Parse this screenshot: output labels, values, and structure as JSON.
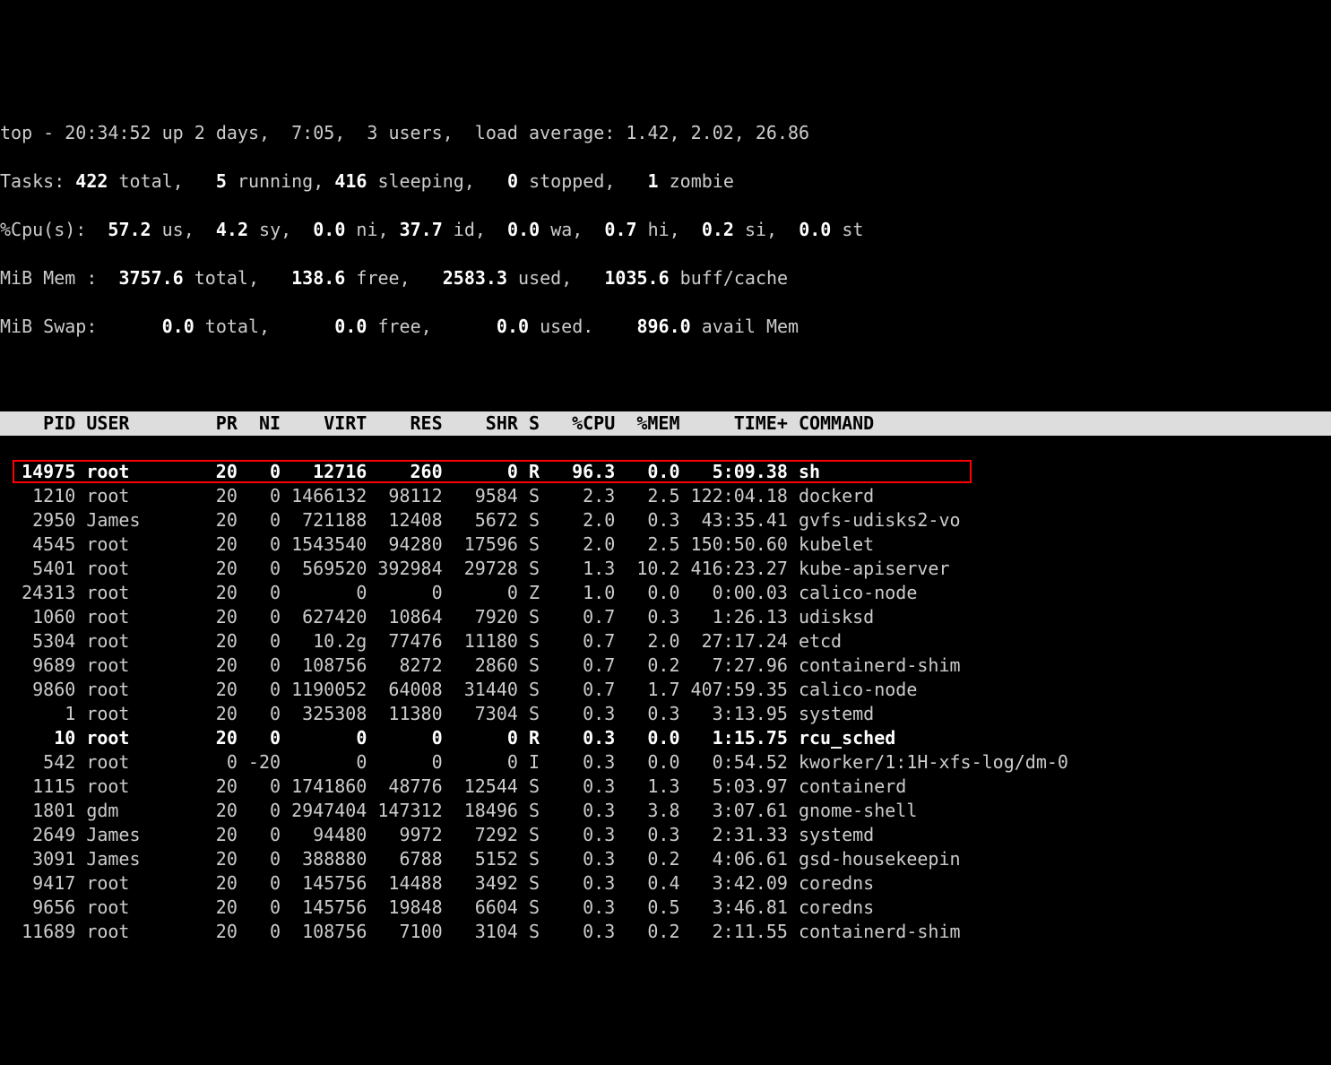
{
  "header": {
    "line1": "top - 20:34:52 up 2 days,  7:05,  3 users,  load average: 1.42, 2.02, 26.86",
    "tasks_label": "Tasks:",
    "tasks_total": "422",
    "tasks_total_label": " total,",
    "tasks_running": "5",
    "tasks_running_label": " running,",
    "tasks_sleeping": "416",
    "tasks_sleeping_label": " sleeping,",
    "tasks_stopped": "0",
    "tasks_stopped_label": " stopped,",
    "tasks_zombie": "1",
    "tasks_zombie_label": " zombie",
    "cpu_label": "%Cpu(s):",
    "cpu_us": "57.2",
    "cpu_us_label": " us,",
    "cpu_sy": "4.2",
    "cpu_sy_label": " sy,",
    "cpu_ni": "0.0",
    "cpu_ni_label": " ni,",
    "cpu_id": "37.7",
    "cpu_id_label": " id,",
    "cpu_wa": "0.0",
    "cpu_wa_label": " wa,",
    "cpu_hi": "0.7",
    "cpu_hi_label": " hi,",
    "cpu_si": "0.2",
    "cpu_si_label": " si,",
    "cpu_st": "0.0",
    "cpu_st_label": " st",
    "mem_label": "MiB Mem :",
    "mem_total": "3757.6",
    "mem_total_label": " total,",
    "mem_free": "138.6",
    "mem_free_label": " free,",
    "mem_used": "2583.3",
    "mem_used_label": " used,",
    "mem_buff": "1035.6",
    "mem_buff_label": " buff/cache",
    "swap_label": "MiB Swap:",
    "swap_total": "0.0",
    "swap_total_label": " total,",
    "swap_free": "0.0",
    "swap_free_label": " free,",
    "swap_used": "0.0",
    "swap_used_label": " used.",
    "swap_avail": "896.0",
    "swap_avail_label": " avail Mem"
  },
  "columns": {
    "pid": "PID",
    "user": "USER",
    "pr": "PR",
    "ni": "NI",
    "virt": "VIRT",
    "res": "RES",
    "shr": "SHR",
    "s": "S",
    "cpu": "%CPU",
    "mem": "%MEM",
    "time": "TIME+",
    "cmd": "COMMAND"
  },
  "rows": [
    {
      "pid": "14975",
      "user": "root",
      "pr": "20",
      "ni": "0",
      "virt": "12716",
      "res": "260",
      "shr": "0",
      "s": "R",
      "cpu": "96.3",
      "mem": "0.0",
      "time": "5:09.38",
      "cmd": "sh",
      "bold": true,
      "hl": true
    },
    {
      "pid": "1210",
      "user": "root",
      "pr": "20",
      "ni": "0",
      "virt": "1466132",
      "res": "98112",
      "shr": "9584",
      "s": "S",
      "cpu": "2.3",
      "mem": "2.5",
      "time": "122:04.18",
      "cmd": "dockerd"
    },
    {
      "pid": "2950",
      "user": "James",
      "pr": "20",
      "ni": "0",
      "virt": "721188",
      "res": "12408",
      "shr": "5672",
      "s": "S",
      "cpu": "2.0",
      "mem": "0.3",
      "time": "43:35.41",
      "cmd": "gvfs-udisks2-vo"
    },
    {
      "pid": "4545",
      "user": "root",
      "pr": "20",
      "ni": "0",
      "virt": "1543540",
      "res": "94280",
      "shr": "17596",
      "s": "S",
      "cpu": "2.0",
      "mem": "2.5",
      "time": "150:50.60",
      "cmd": "kubelet"
    },
    {
      "pid": "5401",
      "user": "root",
      "pr": "20",
      "ni": "0",
      "virt": "569520",
      "res": "392984",
      "shr": "29728",
      "s": "S",
      "cpu": "1.3",
      "mem": "10.2",
      "time": "416:23.27",
      "cmd": "kube-apiserver"
    },
    {
      "pid": "24313",
      "user": "root",
      "pr": "20",
      "ni": "0",
      "virt": "0",
      "res": "0",
      "shr": "0",
      "s": "Z",
      "cpu": "1.0",
      "mem": "0.0",
      "time": "0:00.03",
      "cmd": "calico-node"
    },
    {
      "pid": "1060",
      "user": "root",
      "pr": "20",
      "ni": "0",
      "virt": "627420",
      "res": "10864",
      "shr": "7920",
      "s": "S",
      "cpu": "0.7",
      "mem": "0.3",
      "time": "1:26.13",
      "cmd": "udisksd"
    },
    {
      "pid": "5304",
      "user": "root",
      "pr": "20",
      "ni": "0",
      "virt": "10.2g",
      "res": "77476",
      "shr": "11180",
      "s": "S",
      "cpu": "0.7",
      "mem": "2.0",
      "time": "27:17.24",
      "cmd": "etcd"
    },
    {
      "pid": "9689",
      "user": "root",
      "pr": "20",
      "ni": "0",
      "virt": "108756",
      "res": "8272",
      "shr": "2860",
      "s": "S",
      "cpu": "0.7",
      "mem": "0.2",
      "time": "7:27.96",
      "cmd": "containerd-shim"
    },
    {
      "pid": "9860",
      "user": "root",
      "pr": "20",
      "ni": "0",
      "virt": "1190052",
      "res": "64008",
      "shr": "31440",
      "s": "S",
      "cpu": "0.7",
      "mem": "1.7",
      "time": "407:59.35",
      "cmd": "calico-node"
    },
    {
      "pid": "1",
      "user": "root",
      "pr": "20",
      "ni": "0",
      "virt": "325308",
      "res": "11380",
      "shr": "7304",
      "s": "S",
      "cpu": "0.3",
      "mem": "0.3",
      "time": "3:13.95",
      "cmd": "systemd"
    },
    {
      "pid": "10",
      "user": "root",
      "pr": "20",
      "ni": "0",
      "virt": "0",
      "res": "0",
      "shr": "0",
      "s": "R",
      "cpu": "0.3",
      "mem": "0.0",
      "time": "1:15.75",
      "cmd": "rcu_sched",
      "bold": true
    },
    {
      "pid": "542",
      "user": "root",
      "pr": "0",
      "ni": "-20",
      "virt": "0",
      "res": "0",
      "shr": "0",
      "s": "I",
      "cpu": "0.3",
      "mem": "0.0",
      "time": "0:54.52",
      "cmd": "kworker/1:1H-xfs-log/dm-0"
    },
    {
      "pid": "1115",
      "user": "root",
      "pr": "20",
      "ni": "0",
      "virt": "1741860",
      "res": "48776",
      "shr": "12544",
      "s": "S",
      "cpu": "0.3",
      "mem": "1.3",
      "time": "5:03.97",
      "cmd": "containerd"
    },
    {
      "pid": "1801",
      "user": "gdm",
      "pr": "20",
      "ni": "0",
      "virt": "2947404",
      "res": "147312",
      "shr": "18496",
      "s": "S",
      "cpu": "0.3",
      "mem": "3.8",
      "time": "3:07.61",
      "cmd": "gnome-shell"
    },
    {
      "pid": "2649",
      "user": "James",
      "pr": "20",
      "ni": "0",
      "virt": "94480",
      "res": "9972",
      "shr": "7292",
      "s": "S",
      "cpu": "0.3",
      "mem": "0.3",
      "time": "2:31.33",
      "cmd": "systemd"
    },
    {
      "pid": "3091",
      "user": "James",
      "pr": "20",
      "ni": "0",
      "virt": "388880",
      "res": "6788",
      "shr": "5152",
      "s": "S",
      "cpu": "0.3",
      "mem": "0.2",
      "time": "4:06.61",
      "cmd": "gsd-housekeepin"
    },
    {
      "pid": "9417",
      "user": "root",
      "pr": "20",
      "ni": "0",
      "virt": "145756",
      "res": "14488",
      "shr": "3492",
      "s": "S",
      "cpu": "0.3",
      "mem": "0.4",
      "time": "3:42.09",
      "cmd": "coredns"
    },
    {
      "pid": "9656",
      "user": "root",
      "pr": "20",
      "ni": "0",
      "virt": "145756",
      "res": "19848",
      "shr": "6604",
      "s": "S",
      "cpu": "0.3",
      "mem": "0.5",
      "time": "3:46.81",
      "cmd": "coredns"
    },
    {
      "pid": "11689",
      "user": "root",
      "pr": "20",
      "ni": "0",
      "virt": "108756",
      "res": "7100",
      "shr": "3104",
      "s": "S",
      "cpu": "0.3",
      "mem": "0.2",
      "time": "2:11.55",
      "cmd": "containerd-shim"
    }
  ]
}
